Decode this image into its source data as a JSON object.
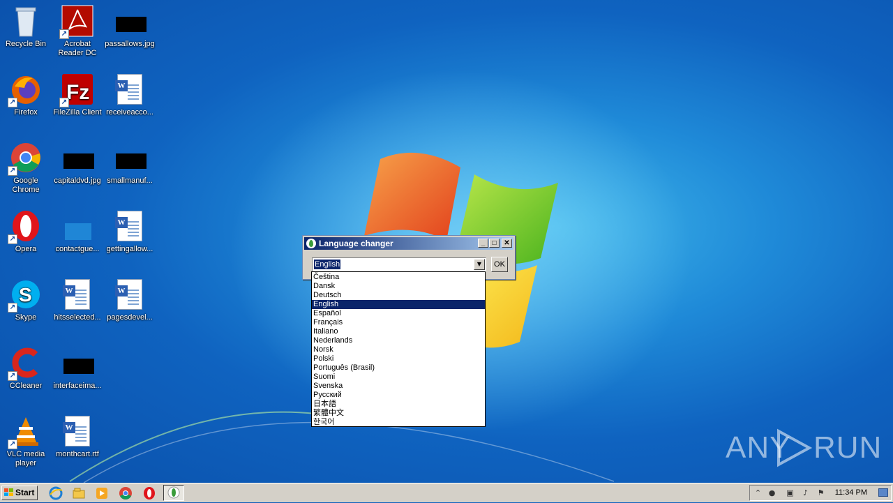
{
  "desktop": {
    "icons": [
      {
        "label": "Recycle Bin",
        "icon": "recycle-bin-icon"
      },
      {
        "label": "Acrobat Reader DC",
        "icon": "acrobat-icon"
      },
      {
        "label": "passallows.jpg",
        "icon": "image-file-icon"
      },
      {
        "label": "Firefox",
        "icon": "firefox-icon"
      },
      {
        "label": "FileZilla Client",
        "icon": "filezilla-icon"
      },
      {
        "label": "receiveacco...",
        "icon": "word-doc-icon"
      },
      {
        "label": "Google Chrome",
        "icon": "chrome-icon"
      },
      {
        "label": "capitaldvd.jpg",
        "icon": "image-file-icon"
      },
      {
        "label": "smallmanuf...",
        "icon": "image-file-icon"
      },
      {
        "label": "Opera",
        "icon": "opera-icon"
      },
      {
        "label": "contactgue...",
        "icon": "file-icon"
      },
      {
        "label": "gettingallow...",
        "icon": "word-doc-icon"
      },
      {
        "label": "Skype",
        "icon": "skype-icon"
      },
      {
        "label": "hitsselected...",
        "icon": "word-doc-icon"
      },
      {
        "label": "pagesdevel...",
        "icon": "word-doc-icon"
      },
      {
        "label": "CCleaner",
        "icon": "ccleaner-icon"
      },
      {
        "label": "interfaceima...",
        "icon": "image-file-icon"
      },
      {
        "label": "VLC media player",
        "icon": "vlc-icon"
      },
      {
        "label": "monthcart.rtf",
        "icon": "word-doc-icon"
      }
    ]
  },
  "window": {
    "title": "Language changer",
    "selected_language": "English",
    "ok_label": "OK",
    "minimize": "_",
    "maximize": "□",
    "close": "✕"
  },
  "dropdown": {
    "options": [
      "Čeština",
      "Dansk",
      "Deutsch",
      "English",
      "Español",
      "Français",
      "Italiano",
      "Nederlands",
      "Norsk",
      "Polski",
      "Português (Brasil)",
      "Suomi",
      "Svenska",
      "Русский",
      "日本語",
      "繁體中文",
      "한국어"
    ],
    "selected_index": 3
  },
  "watermark": {
    "left": "ANY",
    "right": "RUN"
  },
  "taskbar": {
    "start_label": "Start",
    "clock": "11:34 PM",
    "pinned": [
      "internet-explorer-icon",
      "explorer-icon",
      "media-player-icon",
      "chrome-icon",
      "opera-icon"
    ],
    "active_task_icon": "language-changer-icon"
  },
  "colors": {
    "selection": "#0a246a",
    "titlebar_start": "#0a246a",
    "titlebar_end": "#a6caf0"
  }
}
